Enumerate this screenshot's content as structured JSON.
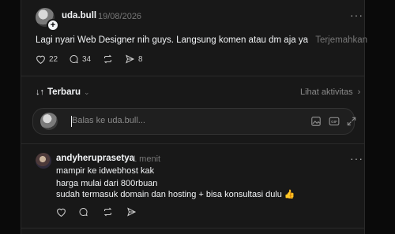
{
  "post": {
    "username": "uda.bull",
    "date": "19/08/2026",
    "text": "Lagi nyari Web Designer nih guys. Langsung komen atau dm aja ya",
    "translate_label": "Terjemahkan",
    "likes": "22",
    "comments": "34",
    "shares": "8"
  },
  "sort": {
    "label": "Terbaru",
    "activity_label": "Lihat aktivitas"
  },
  "reply_box": {
    "placeholder": "Balas ke uda.bull..."
  },
  "reply": {
    "username": "andyheruprasetya",
    "time": "1 menit",
    "lines": [
      "mampir ke idwebhost kak",
      "harga mulai dari 800rbuan",
      "sudah termasuk domain dan hosting + bisa konsultasi dulu 👍"
    ]
  },
  "icons": {
    "like": "heart-icon",
    "comment": "comment-icon",
    "repost": "repost-icon",
    "share": "send-icon",
    "image": "image-icon",
    "gif": "gif-icon",
    "expand": "expand-icon"
  }
}
